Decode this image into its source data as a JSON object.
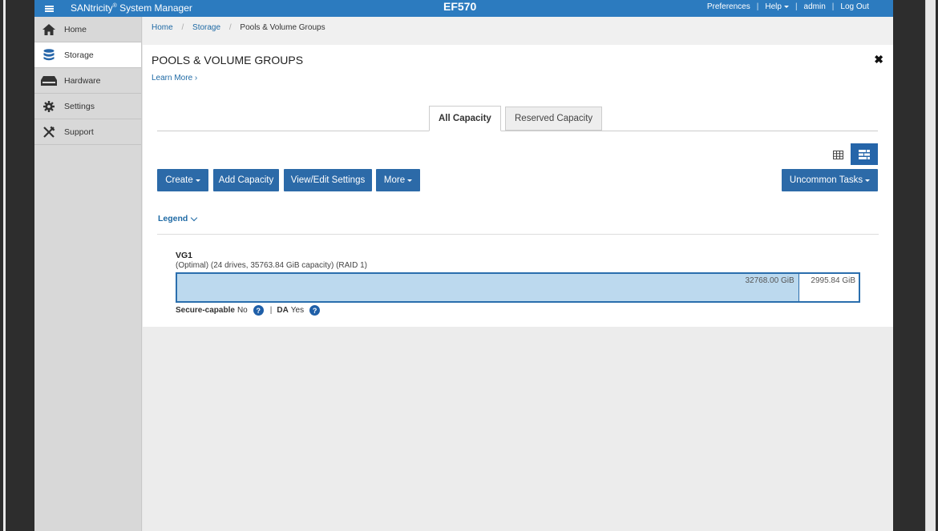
{
  "header": {
    "app_title": "SANtricity",
    "app_title_reg": "®",
    "app_title_suffix": " System Manager",
    "device_name": "EF570",
    "links": {
      "preferences": "Preferences",
      "help": "Help",
      "user": "admin",
      "logout": "Log Out"
    }
  },
  "sidebar": {
    "items": [
      {
        "label": "Home",
        "icon": "home-icon"
      },
      {
        "label": "Storage",
        "icon": "database-icon"
      },
      {
        "label": "Hardware",
        "icon": "hardware-icon"
      },
      {
        "label": "Settings",
        "icon": "gear-icon"
      },
      {
        "label": "Support",
        "icon": "tools-icon"
      }
    ],
    "active": "Storage"
  },
  "breadcrumb": {
    "home": "Home",
    "storage": "Storage",
    "current": "Pools & Volume Groups",
    "separator": "/"
  },
  "page": {
    "title": "POOLS & VOLUME GROUPS",
    "learn_more": "Learn More ›",
    "tabs": [
      "All Capacity",
      "Reserved Capacity"
    ],
    "active_tab": "All Capacity"
  },
  "toolbar": {
    "create": "Create",
    "add_capacity": "Add Capacity",
    "view_edit_settings": "View/Edit Settings",
    "more": "More",
    "uncommon_tasks": "Uncommon Tasks"
  },
  "legend": {
    "label": "Legend"
  },
  "volume_group": {
    "name": "VG1",
    "details": "(Optimal) (24 drives, 35763.84 GiB capacity) (RAID 1)",
    "used_label": "32768.00 GiB",
    "used_gib": 32768.0,
    "free_label": "2995.84 GiB",
    "free_gib": 2995.84,
    "secure_capable_label": "Secure-capable",
    "secure_capable_value": "No",
    "da_label": "DA",
    "da_value": "Yes",
    "separator": "|",
    "help_glyph": "?"
  },
  "colors": {
    "header_blue": "#2c7bbf",
    "button_blue": "#2c6aa8",
    "used_capacity": "#bcd9ee",
    "bar_border": "#2a6ead"
  }
}
